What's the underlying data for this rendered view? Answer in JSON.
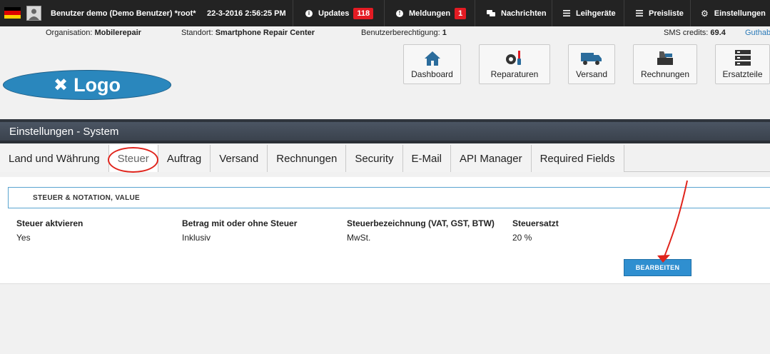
{
  "topbar": {
    "user": "Benutzer demo (Demo Benutzer) *root*",
    "datetime": "22-3-2016 2:56:25 PM",
    "updates_label": "Updates",
    "updates_count": "118",
    "messages_label": "Meldungen",
    "messages_count": "1",
    "news_label": "Nachrichten",
    "loan_label": "Leihgeräte",
    "pricelist_label": "Preisliste",
    "settings_label": "Einstellungen"
  },
  "info": {
    "org_label": "Organisation:",
    "org_value": "Mobilerepair",
    "location_label": "Standort:",
    "location_value": "Smartphone Repair Center",
    "permission_label": "Benutzerberechtigung:",
    "permission_value": "1",
    "sms_label": "SMS credits:",
    "sms_value": "69.4",
    "credit_link": "Guthab"
  },
  "logo": {
    "text": "Logo"
  },
  "nav": {
    "dashboard": "Dashboard",
    "repairs": "Reparaturen",
    "shipping": "Versand",
    "invoices": "Rechnungen",
    "parts": "Ersatzteile"
  },
  "header": {
    "title": "Einstellungen - System"
  },
  "tabs": [
    "Land und Währung",
    "Steuer",
    "Auftrag",
    "Versand",
    "Rechnungen",
    "Security",
    "E-Mail",
    "API Manager",
    "Required Fields"
  ],
  "active_tab": "Steuer",
  "section": {
    "title": "STEUER & NOTATION, VALUE",
    "columns": [
      {
        "label": "Steuer aktvieren",
        "value": "Yes"
      },
      {
        "label": "Betrag mit oder ohne Steuer",
        "value": "Inklusiv"
      },
      {
        "label": "Steuerbezeichnung (VAT, GST, BTW)",
        "value": "MwSt."
      },
      {
        "label": "Steuersatzt",
        "value": "20 %"
      }
    ],
    "edit_button": "BEARBEITEN"
  },
  "colors": {
    "topbar_bg": "#232323",
    "badge_red": "#e31b23",
    "accent_blue": "#2f8fd0",
    "annotation_red": "#e0241c"
  }
}
